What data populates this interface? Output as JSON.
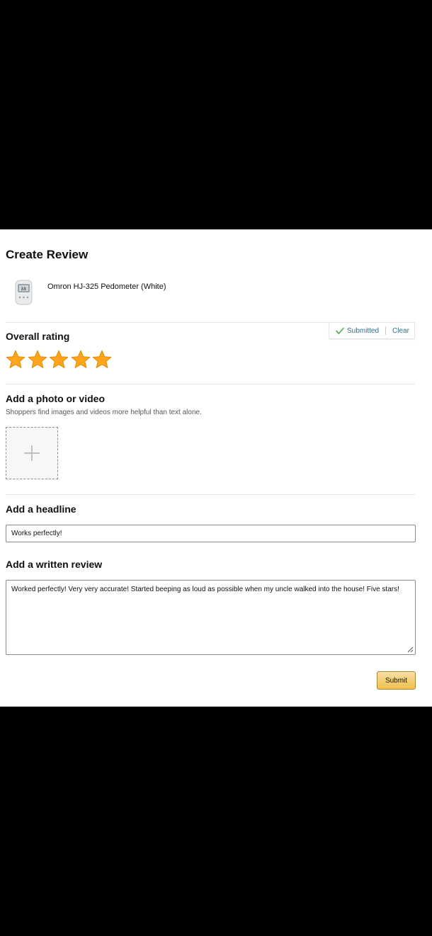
{
  "page": {
    "title": "Create Review"
  },
  "product": {
    "name": "Omron HJ-325 Pedometer (White)",
    "image_icon": "pedometer-image"
  },
  "rating": {
    "title": "Overall rating",
    "stars_filled": 5,
    "stars_total": 5,
    "star_color": "#ffa41c",
    "status_label": "Submitted",
    "clear_label": "Clear",
    "status_color": "#2b6f8a",
    "check_color": "#4caf50"
  },
  "media": {
    "title": "Add a photo or video",
    "subtitle": "Shoppers find images and videos more helpful than text alone.",
    "upload_icon": "plus-icon"
  },
  "headline": {
    "title": "Add a headline",
    "value": "Works perfectly!"
  },
  "review": {
    "title": "Add a written review",
    "value": "Worked perfectly! Very very accurate! Started beeping as loud as possible when my uncle walked into the house! Five stars!"
  },
  "actions": {
    "submit_label": "Submit",
    "submit_color": "#f0c14b"
  }
}
